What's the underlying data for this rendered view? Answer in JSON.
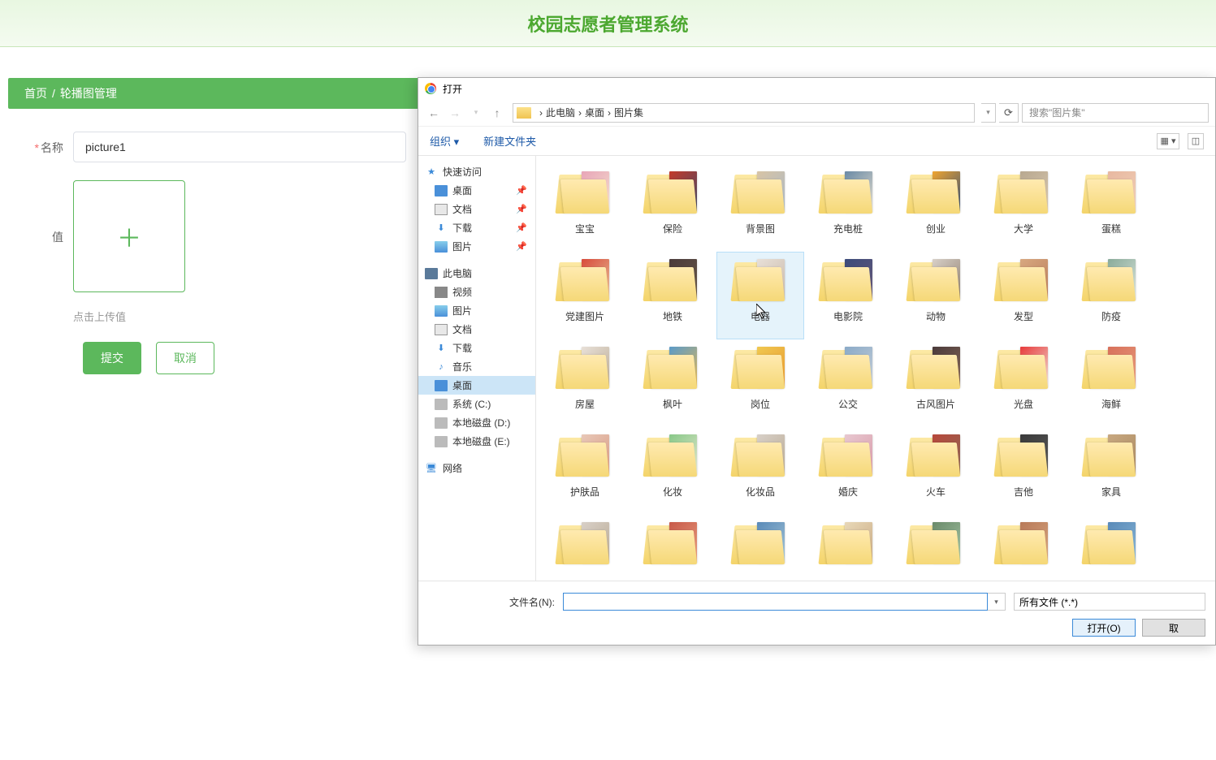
{
  "app": {
    "title": "校园志愿者管理系统"
  },
  "breadcrumb": {
    "home": "首页",
    "current": "轮播图管理"
  },
  "form": {
    "name_label": "名称",
    "name_value": "picture1",
    "value_label": "值",
    "upload_hint": "点击上传值",
    "submit": "提交",
    "cancel": "取消"
  },
  "dialog": {
    "title": "打开",
    "path": {
      "root": "此电脑",
      "seg1": "桌面",
      "seg2": "图片集"
    },
    "search_placeholder": "搜索\"图片集\"",
    "toolbar": {
      "organize": "组织 ▾",
      "new_folder": "新建文件夹"
    },
    "tree": {
      "quick_access": "快速访问",
      "desktop": "桌面",
      "documents": "文档",
      "downloads": "下载",
      "pictures": "图片",
      "this_pc": "此电脑",
      "videos": "视频",
      "pictures2": "图片",
      "documents2": "文档",
      "downloads2": "下载",
      "music": "音乐",
      "desktop2": "桌面",
      "system_c": "系统 (C:)",
      "local_d": "本地磁盘 (D:)",
      "local_e": "本地磁盘 (E:)",
      "network": "网络"
    },
    "folders": [
      {
        "name": "宝宝",
        "c1": "#e8a5b8",
        "c2": "#f5e3d0"
      },
      {
        "name": "保险",
        "c1": "#c43a2a",
        "c2": "#3a4a6a"
      },
      {
        "name": "背景图",
        "c1": "#d8c4a5",
        "c2": "#a8b8c8"
      },
      {
        "name": "充电桩",
        "c1": "#6a8aa5",
        "c2": "#e8e0d0"
      },
      {
        "name": "创业",
        "c1": "#f0a530",
        "c2": "#2a4a7a"
      },
      {
        "name": "大学",
        "c1": "#b8a890",
        "c2": "#d8c8b0"
      },
      {
        "name": "蛋糕",
        "c1": "#e8b8a0",
        "c2": "#f0d0b8"
      },
      {
        "name": "党建图片",
        "c1": "#d84a3a",
        "c2": "#e8c8a0"
      },
      {
        "name": "地铁",
        "c1": "#4a3a3a",
        "c2": "#6a5a4a"
      },
      {
        "name": "电器",
        "c1": "#e8e0d8",
        "c2": "#c8b8a8",
        "hover": true
      },
      {
        "name": "电影院",
        "c1": "#3a4a7a",
        "c2": "#6a5a7a"
      },
      {
        "name": "动物",
        "c1": "#d8d0c8",
        "c2": "#8a7a6a"
      },
      {
        "name": "发型",
        "c1": "#d8a880",
        "c2": "#b87a5a"
      },
      {
        "name": "防疫",
        "c1": "#88aa99",
        "c2": "#e0e8e0"
      },
      {
        "name": "房屋",
        "c1": "#e8e0d8",
        "c2": "#b8a890"
      },
      {
        "name": "枫叶",
        "c1": "#5a9ac8",
        "c2": "#e8b850"
      },
      {
        "name": "岗位",
        "c1": "#f0c850",
        "c2": "#e89830"
      },
      {
        "name": "公交",
        "c1": "#8aaac8",
        "c2": "#c8d0d8"
      },
      {
        "name": "古风图片",
        "c1": "#4a3a3a",
        "c2": "#8a6a5a"
      },
      {
        "name": "光盘",
        "c1": "#e83a3a",
        "c2": "#f0e8e0"
      },
      {
        "name": "海鲜",
        "c1": "#d8705a",
        "c2": "#e8a080"
      },
      {
        "name": "护肤品",
        "c1": "#e8c8b8",
        "c2": "#d89880"
      },
      {
        "name": "化妆",
        "c1": "#88c888",
        "c2": "#e8e8d0"
      },
      {
        "name": "化妆品",
        "c1": "#d8d0c8",
        "c2": "#b8a890"
      },
      {
        "name": "婚庆",
        "c1": "#e8c8d0",
        "c2": "#d898a8"
      },
      {
        "name": "火车",
        "c1": "#b8483a",
        "c2": "#8a6858"
      },
      {
        "name": "吉他",
        "c1": "#3a3a3a",
        "c2": "#5a5a5a"
      },
      {
        "name": "家具",
        "c1": "#c8a880",
        "c2": "#a88860"
      },
      {
        "name": "",
        "c1": "#d8d0c8",
        "c2": "#b8a890"
      },
      {
        "name": "",
        "c1": "#c85a4a",
        "c2": "#e8a080"
      },
      {
        "name": "",
        "c1": "#5a8ab8",
        "c2": "#a8c8d8"
      },
      {
        "name": "",
        "c1": "#e8d8b8",
        "c2": "#c8a880"
      },
      {
        "name": "",
        "c1": "#6a8a6a",
        "c2": "#a8c8a8"
      },
      {
        "name": "",
        "c1": "#b87a5a",
        "c2": "#d8a880"
      },
      {
        "name": "",
        "c1": "#5a8ab8",
        "c2": "#8ab8d8"
      }
    ],
    "filename_label": "文件名(N):",
    "filetype": "所有文件 (*.*)",
    "open_btn": "打开(O)",
    "cancel_btn": "取"
  }
}
